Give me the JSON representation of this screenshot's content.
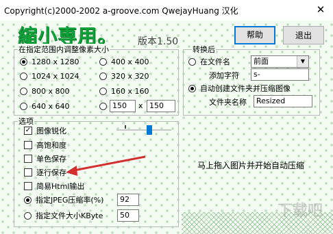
{
  "window": {
    "title": "Copyright(c)2000-2002 a-groove.com QwejayHuang 汉化",
    "close_glyph": "✕"
  },
  "header": {
    "logo_text": "縮小専用。",
    "version": "版本1.50",
    "help_label": "帮助",
    "exit_label": "退出"
  },
  "resize_group": {
    "title": "在指定范围内调整像素大小",
    "options": [
      "1280 x 1280",
      "400 x 400",
      "1024 x 1024",
      "320 x 320",
      "800 x 800",
      "160 x 160",
      "640 x 640"
    ],
    "selected_option": "1280 x 1280",
    "custom_width": "150",
    "custom_height": "150",
    "times_sign": "x"
  },
  "convert_group": {
    "title": "转换后",
    "filename_label": "在文件名",
    "position_value": "前面",
    "add_char_label": "添加字符",
    "add_char_value": "s-",
    "auto_folder_label": "自动创建文件夹并压缩图像",
    "folder_name_label": "文件夹名称",
    "folder_name_value": "Resized",
    "selected": "auto_folder"
  },
  "options_group": {
    "title": "选项",
    "sharpen_label": "图像锐化",
    "sharpen_checked": true,
    "saturation_label": "高饱和度",
    "mono_label": "单色保存",
    "progressive_label": "逐行保存",
    "html_label": "简易Html输出",
    "jpeg_label": "指定JPEG压缩率(%)",
    "jpeg_value": "92",
    "size_label": "指定文件大小KByte",
    "size_value": "50",
    "selected_mode": "jpeg"
  },
  "hint_text": "马上拖入图片并开始自动压缩",
  "watermark_text": "下载吧",
  "colors": {
    "logo": "#10a23a",
    "arrow": "#d32f2f",
    "accent_border": "#0078d7"
  }
}
